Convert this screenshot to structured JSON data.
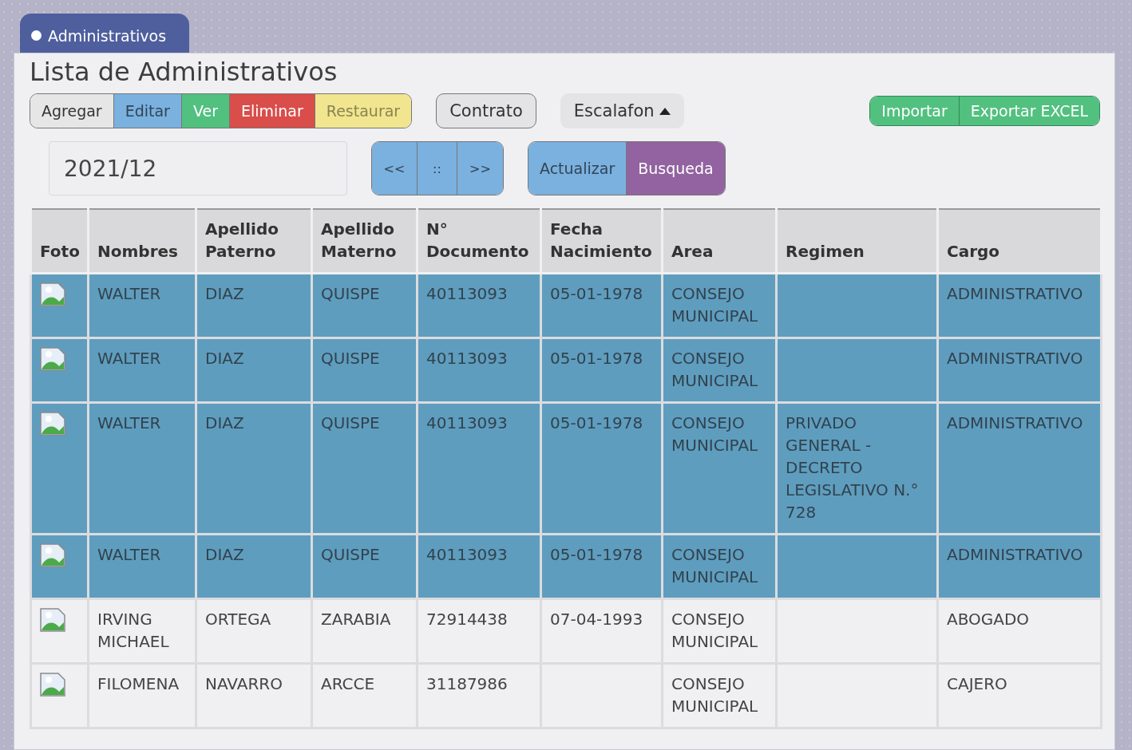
{
  "tab": {
    "label": "Administrativos",
    "selected": true
  },
  "title": "Lista de Administrativos",
  "actions": [
    {
      "label": "Agregar",
      "kind": "plain"
    },
    {
      "label": "Editar",
      "kind": "blue"
    },
    {
      "label": "Ver",
      "kind": "green"
    },
    {
      "label": "Eliminar",
      "kind": "red"
    },
    {
      "label": "Restaurar",
      "kind": "yellow"
    }
  ],
  "contract_button": "Contrato",
  "scale_menu": {
    "label": "Escalafon",
    "expanded": true
  },
  "file_actions": [
    "Importar",
    "Exportar EXCEL"
  ],
  "period_field": {
    "value": "2021/12"
  },
  "pager": [
    "<<",
    "::",
    ">>"
  ],
  "query_actions": [
    {
      "label": "Actualizar",
      "kind": "blue"
    },
    {
      "label": "Busqueda",
      "kind": "purple"
    }
  ],
  "table": {
    "columns": [
      "Foto",
      "Nombres",
      "Apellido Paterno",
      "Apellido Materno",
      "N° Documento",
      "Fecha Nacimiento",
      "Area",
      "Regimen",
      "Cargo"
    ],
    "rows": [
      {
        "selected": true,
        "cells": [
          "",
          "WALTER",
          "DIAZ",
          "QUISPE",
          "40113093",
          "05-01-1978",
          "CONSEJO MUNICIPAL",
          "",
          "ADMINISTRATIVO"
        ]
      },
      {
        "selected": true,
        "cells": [
          "",
          "WALTER",
          "DIAZ",
          "QUISPE",
          "40113093",
          "05-01-1978",
          "CONSEJO MUNICIPAL",
          "",
          "ADMINISTRATIVO"
        ]
      },
      {
        "selected": true,
        "cells": [
          "",
          "WALTER",
          "DIAZ",
          "QUISPE",
          "40113093",
          "05-01-1978",
          "CONSEJO MUNICIPAL",
          "PRIVADO GENERAL - DECRETO LEGISLATIVO N.° 728",
          "ADMINISTRATIVO"
        ]
      },
      {
        "selected": true,
        "cells": [
          "",
          "WALTER",
          "DIAZ",
          "QUISPE",
          "40113093",
          "05-01-1978",
          "CONSEJO MUNICIPAL",
          "",
          "ADMINISTRATIVO"
        ]
      },
      {
        "selected": false,
        "cells": [
          "",
          "IRVING MICHAEL",
          "ORTEGA",
          "ZARABIA",
          "72914438",
          "07-04-1993",
          "CONSEJO MUNICIPAL",
          "",
          "ABOGADO"
        ]
      },
      {
        "selected": false,
        "cells": [
          "",
          "FILOMENA",
          "NAVARRO",
          "ARCCE",
          "31187986",
          "",
          "CONSEJO MUNICIPAL",
          "",
          "CAJERO"
        ]
      }
    ]
  }
}
